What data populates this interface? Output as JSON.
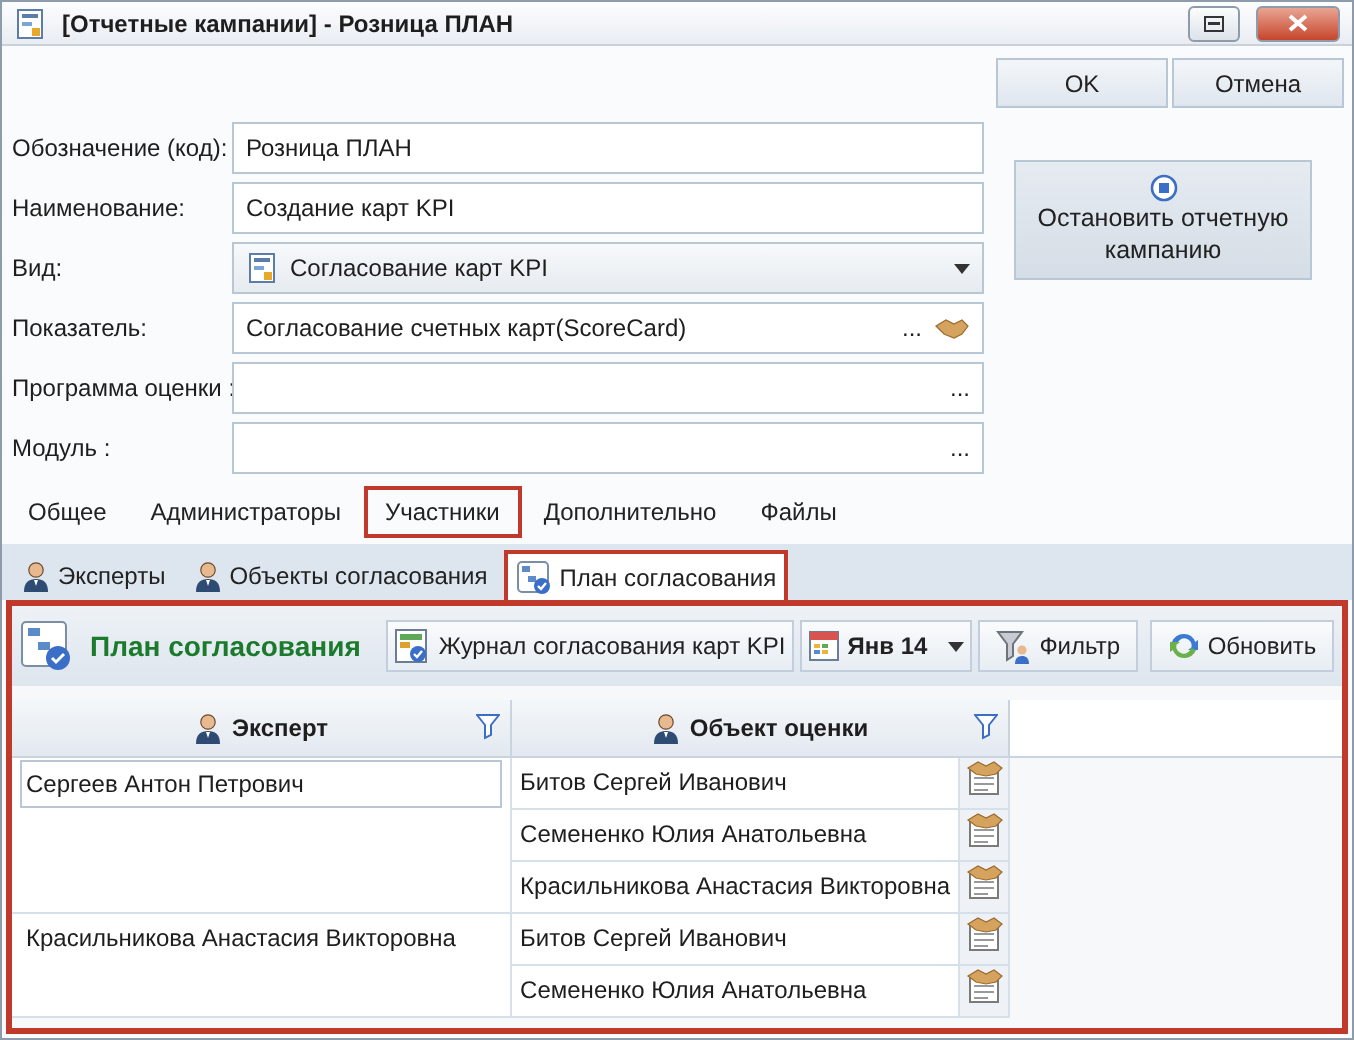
{
  "window": {
    "title": "[Отчетные кампании] - Розница ПЛАН"
  },
  "buttons": [
    {
      "label": "OK"
    },
    {
      "label": "Отмена"
    }
  ],
  "fields": [
    {
      "label": "Обозначение (код):",
      "kind": "text",
      "value": "Розница ПЛАН"
    },
    {
      "label": "Наименование:",
      "kind": "text",
      "value": "Создание карт KPI"
    },
    {
      "label": "Вид:",
      "kind": "combo",
      "value": "Согласование карт KPI"
    },
    {
      "label": "Показатель:",
      "kind": "lookup",
      "value": "Согласование счетных карт(ScoreCard)",
      "ellipsis": "...",
      "link": true
    },
    {
      "label": "Программа оценки :",
      "kind": "lookup",
      "ellipsis": "...",
      "link": false
    },
    {
      "label": "Модуль :",
      "kind": "lookup",
      "ellipsis": "...",
      "link": false
    }
  ],
  "stop_button": {
    "label": "Остановить отчетную кампанию"
  },
  "tabs": [
    {
      "label": "Общее",
      "selected": false
    },
    {
      "label": "Администраторы",
      "selected": false
    },
    {
      "label": "Участники",
      "selected": true
    },
    {
      "label": "Дополнительно",
      "selected": false
    },
    {
      "label": "Файлы",
      "selected": false
    }
  ],
  "subtabs": [
    {
      "label": "Эксперты",
      "kind": "person",
      "selected": false
    },
    {
      "label": "Объекты согласования",
      "kind": "person",
      "selected": false
    },
    {
      "label": "План согласования",
      "kind": "plan",
      "selected": true
    }
  ],
  "panel": {
    "title": "План согласования",
    "toolbar": [
      {
        "label": "Журнал согласования карт KPI",
        "kind": "journal"
      },
      {
        "label": "Янв 14",
        "kind": "period"
      },
      {
        "label": "Фильтр",
        "kind": "filter"
      },
      {
        "label": "Обновить",
        "kind": "refresh"
      }
    ],
    "columns": [
      "Эксперт",
      "Объект оценки"
    ],
    "groups": [
      {
        "expert": "Сергеев Антон Петрович",
        "focused": true,
        "objects": [
          "Битов Сергей Иванович",
          "Семененко Юлия Анатольевна",
          "Красильникова Анастасия Викторовна"
        ]
      },
      {
        "expert": "Красильникова Анастасия Викторовна",
        "focused": false,
        "objects": [
          "Битов Сергей Иванович",
          "Семененко Юлия Анатольевна"
        ]
      }
    ]
  }
}
